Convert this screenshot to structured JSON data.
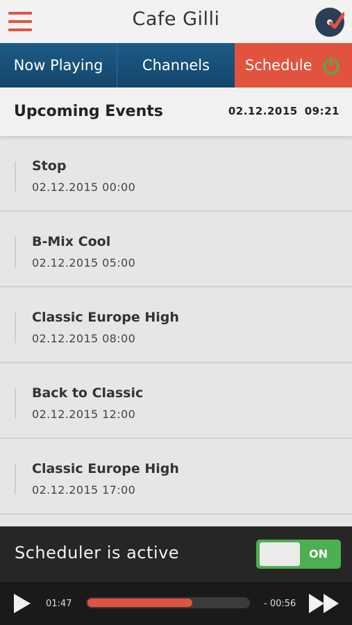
{
  "header": {
    "title": "Cafe Gilli",
    "menu_icon": "hamburger-icon",
    "logo_icon": "vinyl-check-icon",
    "accent_color": "#e2533f"
  },
  "tabs": [
    {
      "label": "Now Playing",
      "active": false
    },
    {
      "label": "Channels",
      "active": false
    },
    {
      "label": "Schedule",
      "active": true,
      "icon": "power-icon"
    }
  ],
  "upcoming": {
    "title": "Upcoming Events",
    "date": "02.12.2015",
    "time": "09:21"
  },
  "events": [
    {
      "name": "Stop",
      "datetime": "02.12.2015 00:00"
    },
    {
      "name": "B-Mix Cool",
      "datetime": "02.12.2015 05:00"
    },
    {
      "name": "Classic Europe High",
      "datetime": "02.12.2015 08:00"
    },
    {
      "name": "Back to Classic",
      "datetime": "02.12.2015 12:00"
    },
    {
      "name": "Classic Europe High",
      "datetime": "02.12.2015 17:00"
    }
  ],
  "scheduler": {
    "label": "Scheduler is active",
    "toggle_label": "ON",
    "toggle_on": true,
    "toggle_color": "#4caf50"
  },
  "player": {
    "elapsed": "01:47",
    "remaining": "- 00:56",
    "progress_fraction": 0.65,
    "play_icon": "play-icon",
    "forward_icon": "fast-forward-icon"
  }
}
